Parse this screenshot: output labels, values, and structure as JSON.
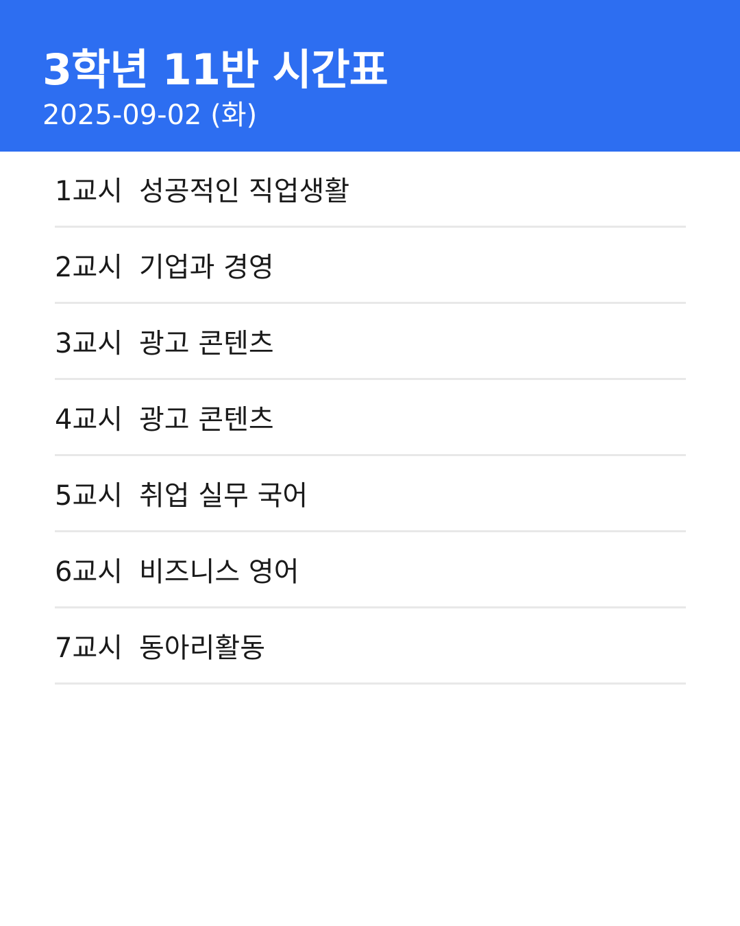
{
  "header": {
    "title": "3학년 11반 시간표",
    "date": "2025-09-02 (화)",
    "background_color": "#2d6ef1"
  },
  "schedule": [
    {
      "period": "1교시",
      "subject": "성공적인 직업생활"
    },
    {
      "period": "2교시",
      "subject": "기업과 경영"
    },
    {
      "period": "3교시",
      "subject": "광고 콘텐츠"
    },
    {
      "period": "4교시",
      "subject": "광고 콘텐츠"
    },
    {
      "period": "5교시",
      "subject": "취업 실무 국어"
    },
    {
      "period": "6교시",
      "subject": "비즈니스 영어"
    },
    {
      "period": "7교시",
      "subject": "동아리활동"
    }
  ]
}
